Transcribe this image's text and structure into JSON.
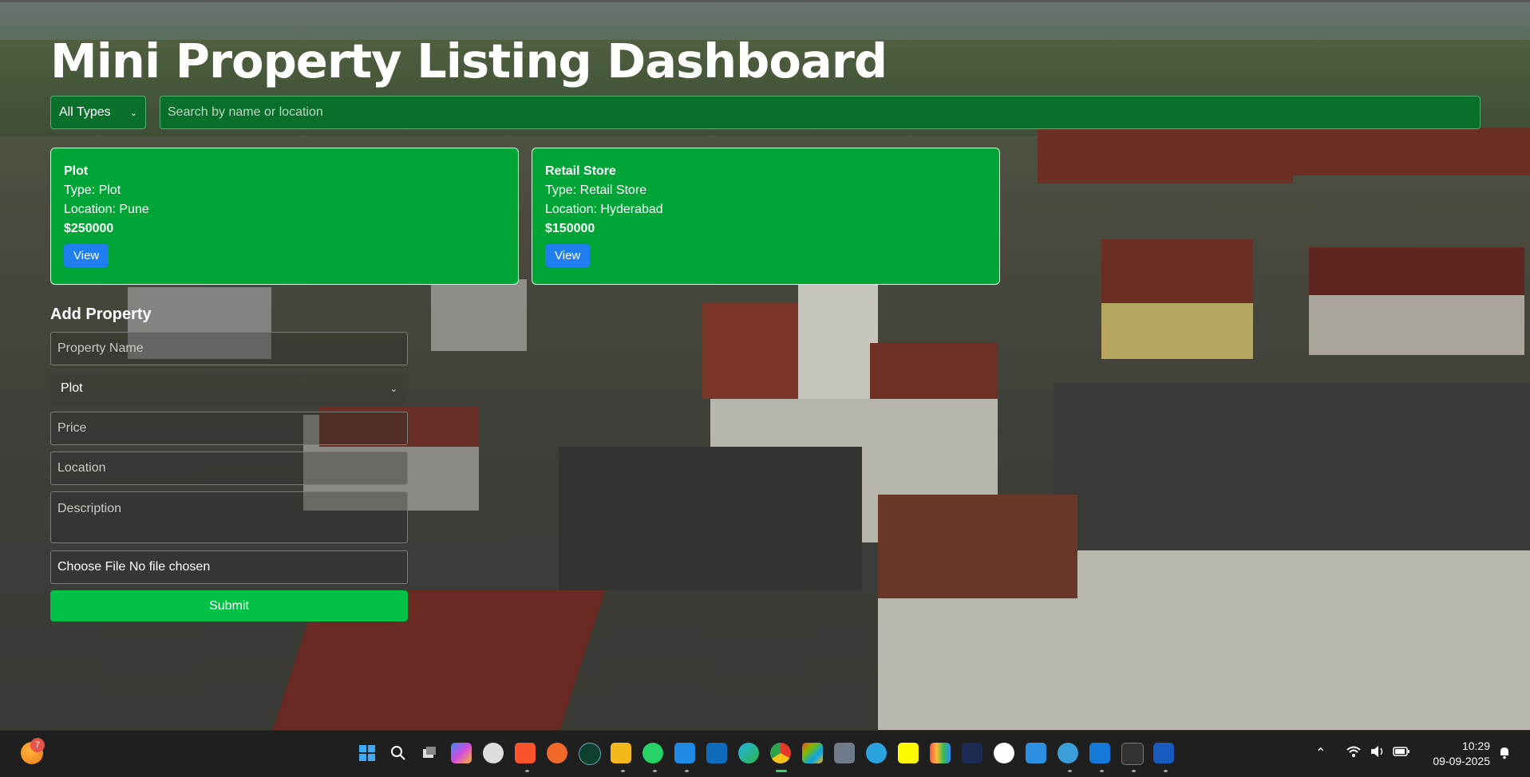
{
  "page": {
    "title": "Mini Property Listing Dashboard"
  },
  "filters": {
    "type_selected": "All Types",
    "search_placeholder": "Search by name or location"
  },
  "listings": [
    {
      "name": "Plot",
      "type_line": "Type: Plot",
      "location_line": "Location: Pune",
      "price": "$250000",
      "action": "View"
    },
    {
      "name": "Retail Store",
      "type_line": "Type: Retail Store",
      "location_line": "Location: Hyderabad",
      "price": "$150000",
      "action": "View"
    }
  ],
  "form": {
    "heading": "Add Property",
    "name_placeholder": "Property Name",
    "type_selected": "Plot",
    "price_placeholder": "Price",
    "location_placeholder": "Location",
    "description_placeholder": "Description",
    "file_label": "Choose File No file chosen",
    "submit_label": "Submit"
  },
  "taskbar": {
    "notification_count": "7",
    "time": "10:29",
    "date": "09-09-2025",
    "apps": [
      "start-icon",
      "search-icon",
      "task-view-icon",
      "copilot-icon",
      "whatsapp-web-icon",
      "brave-icon",
      "swift-icon",
      "dark-app-icon",
      "file-explorer-icon",
      "whatsapp-icon",
      "vscode-icon",
      "outlook-icon",
      "edge-icon",
      "chrome-icon",
      "store-icon",
      "calculator-icon",
      "telegram-icon",
      "snapchat-icon",
      "library-icon",
      "dark-square-icon",
      "github-icon",
      "photos-icon",
      "browser-icon",
      "mail-icon",
      "terminal-icon",
      "word-icon"
    ]
  }
}
